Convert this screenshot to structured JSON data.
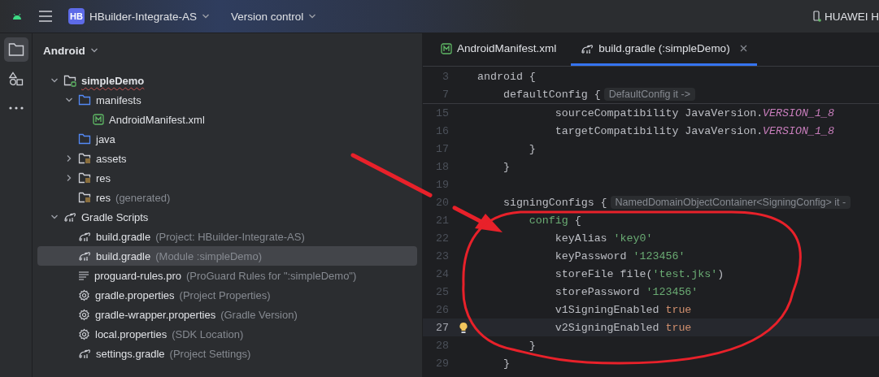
{
  "top_bar": {
    "project": {
      "badge": "HB",
      "name": "HBuilder-Integrate-AS"
    },
    "vcs": "Version control",
    "device": "HUAWEI H"
  },
  "rail": [
    {
      "kind": "folder",
      "selected": true
    },
    {
      "kind": "shapes",
      "selected": false
    },
    {
      "kind": "more",
      "selected": false
    }
  ],
  "project_panel": {
    "view": "Android",
    "tree": [
      {
        "label": "simpleDemo",
        "kind": "module",
        "expanded": true,
        "selected": false,
        "children": [
          {
            "label": "manifests",
            "kind": "folder",
            "expanded": true,
            "selected": false,
            "children": [
              {
                "label": "AndroidManifest.xml",
                "kind": "manifest",
                "selected": false
              }
            ]
          },
          {
            "label": "java",
            "kind": "folder",
            "selected": false
          },
          {
            "label": "assets",
            "kind": "resfolder",
            "expanded": false,
            "selected": false
          },
          {
            "label": "res",
            "kind": "resfolder",
            "expanded": false,
            "selected": false
          },
          {
            "label": "res",
            "detail": "(generated)",
            "kind": "resfolder",
            "selected": false
          }
        ]
      },
      {
        "label": "Gradle Scripts",
        "kind": "gradle",
        "expanded": true,
        "selected": false,
        "children": [
          {
            "label": "build.gradle",
            "detail": "(Project: HBuilder-Integrate-AS)",
            "kind": "gradle",
            "selected": false
          },
          {
            "label": "build.gradle",
            "detail": "(Module :simpleDemo)",
            "kind": "gradle",
            "selected": true
          },
          {
            "label": "proguard-rules.pro",
            "detail": "(ProGuard Rules for \":simpleDemo\")",
            "kind": "lines",
            "selected": false
          },
          {
            "label": "gradle.properties",
            "detail": "(Project Properties)",
            "kind": "gear",
            "selected": false
          },
          {
            "label": "gradle-wrapper.properties",
            "detail": "(Gradle Version)",
            "kind": "gear",
            "selected": false
          },
          {
            "label": "local.properties",
            "detail": "(SDK Location)",
            "kind": "gear",
            "selected": false
          },
          {
            "label": "settings.gradle",
            "detail": "(Project Settings)",
            "kind": "gradle",
            "selected": false
          }
        ]
      }
    ]
  },
  "editor": {
    "tabs": [
      {
        "label": "AndroidManifest.xml",
        "kind": "manifest",
        "selected": false
      },
      {
        "label": "build.gradle (:simpleDemo)",
        "kind": "gradle",
        "selected": true
      }
    ],
    "sticky_lines": [
      {
        "n": "3",
        "tokens": [
          {
            "text": "android {",
            "kind": "plain"
          }
        ]
      },
      {
        "n": "7",
        "tokens": [
          {
            "text": "    defaultConfig {",
            "kind": "plain"
          },
          {
            "text": "DefaultConfig it ->",
            "kind": "hint"
          }
        ]
      }
    ],
    "lines": [
      {
        "n": "15",
        "current": false,
        "bulb": false,
        "tokens": [
          {
            "text": "            sourceCompatibility JavaVersion.",
            "kind": "plain"
          },
          {
            "text": "VERSION_1_8",
            "kind": "constant"
          }
        ]
      },
      {
        "n": "16",
        "current": false,
        "bulb": false,
        "tokens": [
          {
            "text": "            targetCompatibility JavaVersion.",
            "kind": "plain"
          },
          {
            "text": "VERSION_1_8",
            "kind": "constant"
          }
        ]
      },
      {
        "n": "17",
        "current": false,
        "bulb": false,
        "tokens": [
          {
            "text": "        }",
            "kind": "plain"
          }
        ]
      },
      {
        "n": "18",
        "current": false,
        "bulb": false,
        "tokens": [
          {
            "text": "    }",
            "kind": "plain"
          }
        ]
      },
      {
        "n": "19",
        "current": false,
        "bulb": false
      },
      {
        "n": "20",
        "current": false,
        "bulb": false,
        "tokens": [
          {
            "text": "    signingConfigs {",
            "kind": "plain"
          },
          {
            "text": "NamedDomainObjectContainer<SigningConfig> it -",
            "kind": "hint"
          }
        ]
      },
      {
        "n": "21",
        "current": false,
        "bulb": false,
        "tokens": [
          {
            "text": "        config",
            "kind": "method"
          },
          {
            "text": " {",
            "kind": "plain"
          }
        ]
      },
      {
        "n": "22",
        "current": false,
        "bulb": false,
        "tokens": [
          {
            "text": "            keyAlias ",
            "kind": "plain"
          },
          {
            "text": "'key0'",
            "kind": "string"
          }
        ]
      },
      {
        "n": "23",
        "current": false,
        "bulb": false,
        "tokens": [
          {
            "text": "            keyPassword ",
            "kind": "plain"
          },
          {
            "text": "'123456'",
            "kind": "string"
          }
        ]
      },
      {
        "n": "24",
        "current": false,
        "bulb": false,
        "tokens": [
          {
            "text": "            storeFile file(",
            "kind": "plain"
          },
          {
            "text": "'test.jks'",
            "kind": "string"
          },
          {
            "text": ")",
            "kind": "plain"
          }
        ]
      },
      {
        "n": "25",
        "current": false,
        "bulb": false,
        "tokens": [
          {
            "text": "            storePassword ",
            "kind": "plain"
          },
          {
            "text": "'123456'",
            "kind": "string"
          }
        ]
      },
      {
        "n": "26",
        "current": false,
        "bulb": false,
        "tokens": [
          {
            "text": "            v1SigningEnabled ",
            "kind": "plain"
          },
          {
            "text": "true",
            "kind": "keyword"
          }
        ]
      },
      {
        "n": "27",
        "current": true,
        "bulb": true,
        "tokens": [
          {
            "text": "            v2SigningEnabled ",
            "kind": "plain"
          },
          {
            "text": "true",
            "kind": "keyword"
          }
        ]
      },
      {
        "n": "28",
        "current": false,
        "bulb": false,
        "tokens": [
          {
            "text": "        }",
            "kind": "plain"
          }
        ]
      },
      {
        "n": "29",
        "current": false,
        "bulb": false,
        "tokens": [
          {
            "text": "    }",
            "kind": "plain"
          }
        ]
      }
    ]
  },
  "annotation": {
    "kind": "arrow-and-ellipse"
  }
}
